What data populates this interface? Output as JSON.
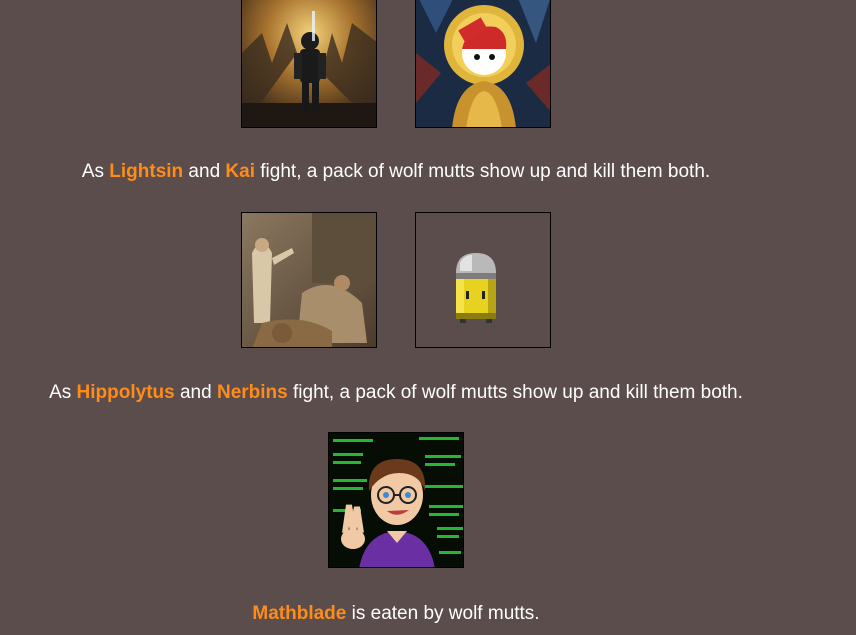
{
  "events": [
    {
      "avatars": [
        {
          "icon": "armored-soldier-ruins-avatar"
        },
        {
          "icon": "haloed-countryball-stained-glass-avatar"
        }
      ],
      "prefix": "As ",
      "name1": "Lightsin",
      "middle": " and ",
      "name2": "Kai",
      "suffix": " fight, a pack of wolf mutts show up and kill them both."
    },
    {
      "avatars": [
        {
          "icon": "classical-painting-hippolytus-avatar"
        },
        {
          "icon": "yellow-bullet-sprite-avatar"
        }
      ],
      "prefix": "As ",
      "name1": "Hippolytus",
      "middle": " and ",
      "name2": "Nerbins",
      "suffix": " fight, a pack of wolf mutts show up and kill them both."
    },
    {
      "avatars": [
        {
          "icon": "cartoon-coder-matrix-avatar"
        }
      ],
      "name1": "Mathblade",
      "suffix": " is eaten by wolf mutts."
    }
  ],
  "colors": {
    "background": "#5a4d4c",
    "name_highlight": "#ff8c1a",
    "text": "#ffffff"
  }
}
